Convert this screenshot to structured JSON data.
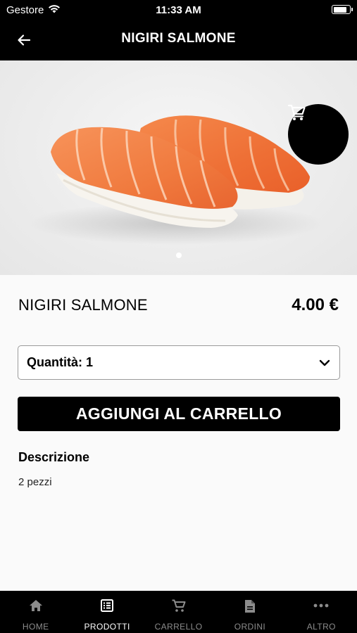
{
  "status_bar": {
    "carrier": "Gestore",
    "time": "11:33 AM",
    "battery_level": 0.9
  },
  "header": {
    "title": "NIGIRI SALMONE",
    "back_icon": "arrow-left-icon"
  },
  "gallery": {
    "image": "salmon-nigiri-photo",
    "page_count": 1,
    "current_page": 1
  },
  "cart_button": {
    "icon": "shopping-cart-icon"
  },
  "product": {
    "name": "NIGIRI SALMONE",
    "price": "4.00 €",
    "quantity_label": "Quantità: 1",
    "add_to_cart_label": "AGGIUNGI AL CARRELLO",
    "description_title": "Descrizione",
    "description": "2 pezzi"
  },
  "tabs": [
    {
      "label": "HOME",
      "icon": "home-icon",
      "active": false
    },
    {
      "label": "PRODOTTI",
      "icon": "list-icon",
      "active": true
    },
    {
      "label": "CARRELLO",
      "icon": "cart-icon",
      "active": false
    },
    {
      "label": "ORDINI",
      "icon": "document-icon",
      "active": false
    },
    {
      "label": "ALTRO",
      "icon": "more-icon",
      "active": false
    }
  ],
  "colors": {
    "primary": "#000000",
    "background": "#fafafa",
    "inactive_tab": "#8c8c8c",
    "salmon": "#f07a3e"
  }
}
